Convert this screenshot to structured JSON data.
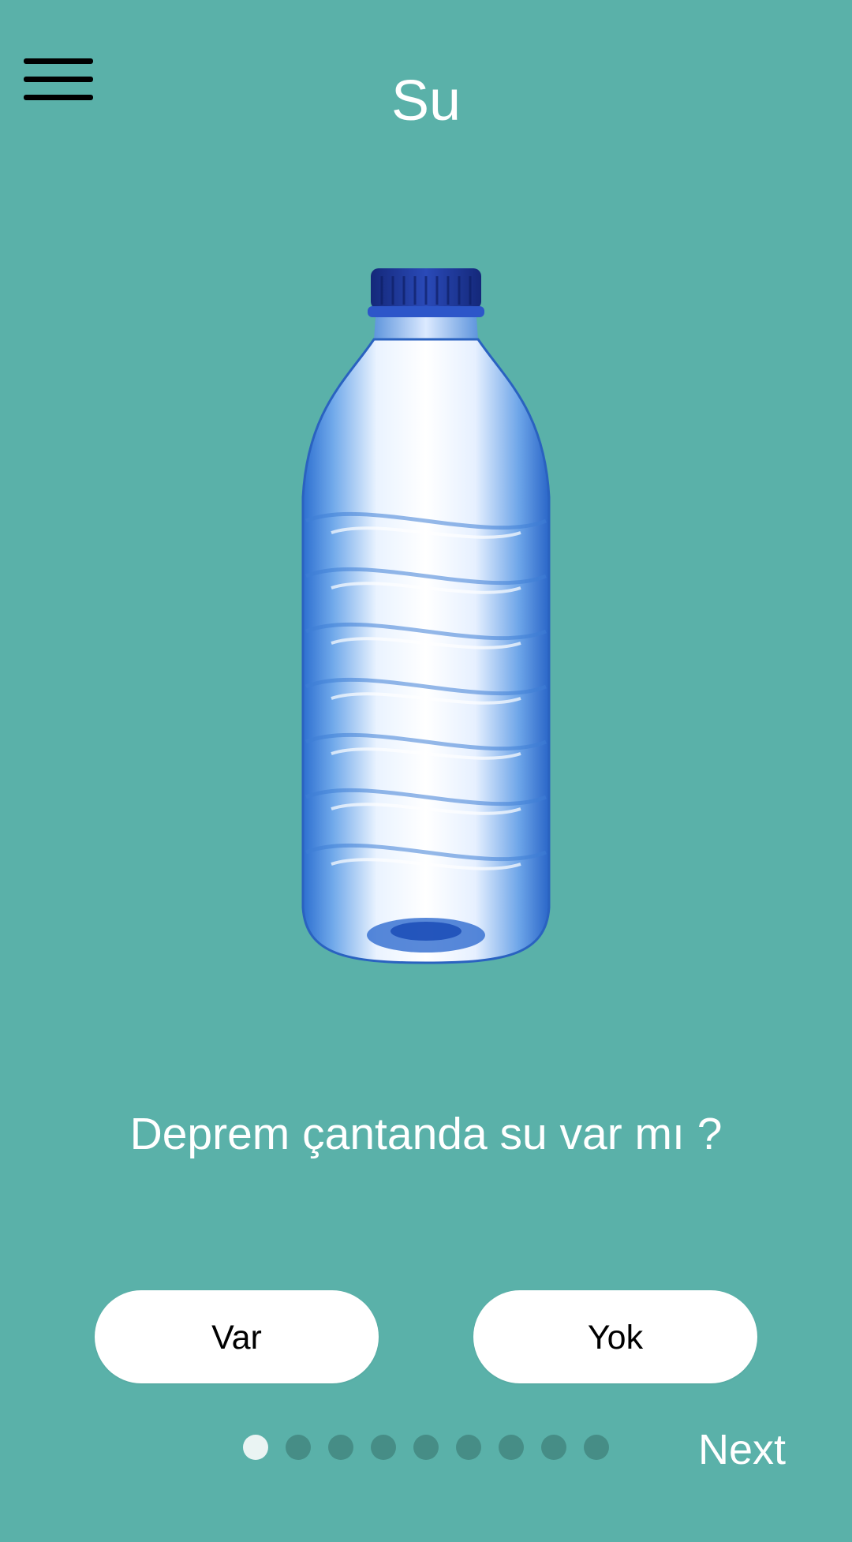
{
  "header": {
    "title": "Su",
    "menu_icon": "hamburger-menu-icon"
  },
  "image": {
    "subject": "water-bottle",
    "colors": {
      "cap": "#1E3A9B",
      "liquid_highlight": "#ffffff",
      "plastic": "#4E8EE0"
    }
  },
  "question": {
    "text": "Deprem çantanda su var mı ?"
  },
  "answers": {
    "yes_label": "Var",
    "no_label": "Yok"
  },
  "pagination": {
    "total": 9,
    "current": 1
  },
  "navigation": {
    "next_label": "Next"
  },
  "colors": {
    "background": "#5AB1A9",
    "dot_inactive": "#468D86",
    "dot_active": "#EAF4F3",
    "button_bg": "#FFFFFF",
    "text": "#FFFFFF"
  }
}
